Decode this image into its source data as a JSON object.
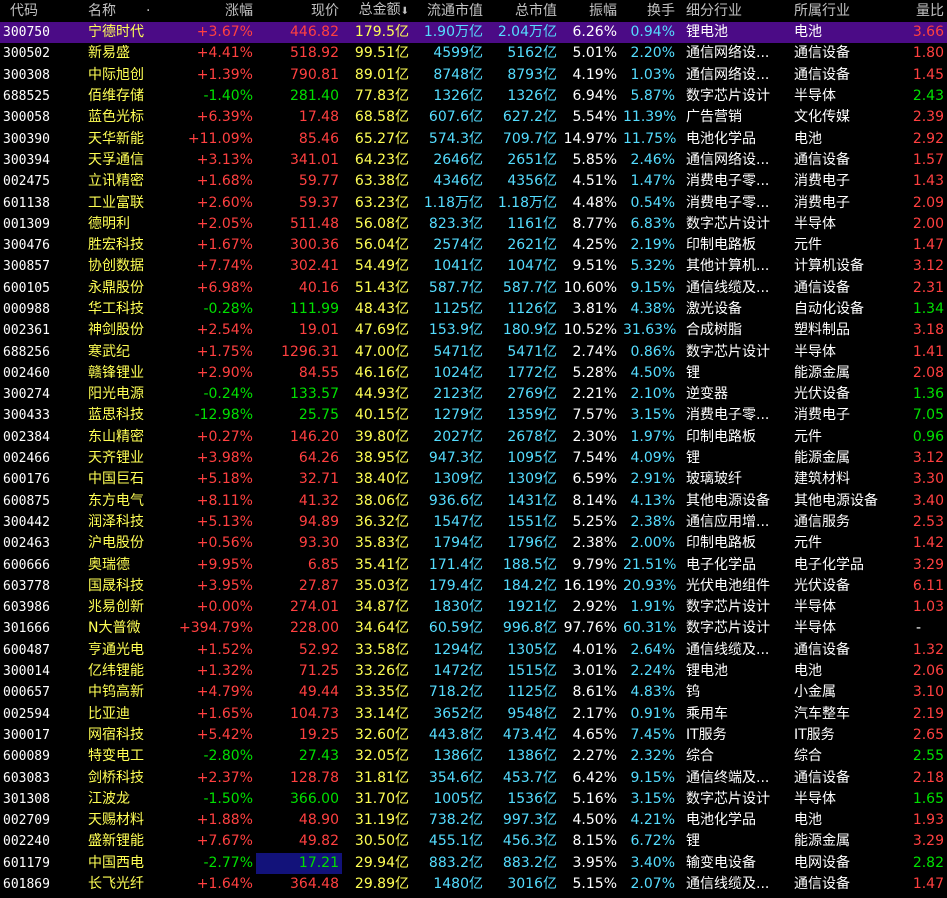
{
  "header": {
    "code": "代码",
    "name": "名称",
    "dot": "·",
    "change": "涨幅",
    "price": "现价",
    "amount": "总金额",
    "sort_arrow": "⬇",
    "float_cap": "流通市值",
    "total_cap": "总市值",
    "amplitude": "振幅",
    "turnover": "换手",
    "sub_industry": "细分行业",
    "industry": "所属行业",
    "volume_ratio": "量比"
  },
  "colors": {
    "up": "#ff4040",
    "down": "#00e000",
    "selected_row": "#4b0b86",
    "name": "#ffff55",
    "cap": "#55ddff"
  },
  "rows": [
    {
      "code": "300750",
      "name": "宁德时代",
      "change": "+3.67%",
      "price": "446.82",
      "amount": "179.5亿",
      "float_cap": "1.90万亿",
      "total_cap": "2.04万亿",
      "amplitude": "6.26%",
      "turnover": "0.94%",
      "sub_industry": "锂电池",
      "industry": "电池",
      "volume_ratio": "3.66",
      "dir": "up",
      "selected": true
    },
    {
      "code": "300502",
      "name": "新易盛",
      "change": "+4.41%",
      "price": "518.92",
      "amount": "99.51亿",
      "float_cap": "4599亿",
      "total_cap": "5162亿",
      "amplitude": "5.01%",
      "turnover": "2.20%",
      "sub_industry": "通信网络设...",
      "industry": "通信设备",
      "volume_ratio": "1.80",
      "dir": "up"
    },
    {
      "code": "300308",
      "name": "中际旭创",
      "change": "+1.39%",
      "price": "790.81",
      "amount": "89.01亿",
      "float_cap": "8748亿",
      "total_cap": "8793亿",
      "amplitude": "4.19%",
      "turnover": "1.03%",
      "sub_industry": "通信网络设...",
      "industry": "通信设备",
      "volume_ratio": "1.45",
      "dir": "up"
    },
    {
      "code": "688525",
      "name": "佰维存储",
      "change": "-1.40%",
      "price": "281.40",
      "amount": "77.83亿",
      "float_cap": "1326亿",
      "total_cap": "1326亿",
      "amplitude": "6.94%",
      "turnover": "5.87%",
      "sub_industry": "数字芯片设计",
      "industry": "半导体",
      "volume_ratio": "2.43",
      "dir": "dn"
    },
    {
      "code": "300058",
      "name": "蓝色光标",
      "change": "+6.39%",
      "price": "17.48",
      "amount": "68.58亿",
      "float_cap": "607.6亿",
      "total_cap": "627.2亿",
      "amplitude": "5.54%",
      "turnover": "11.39%",
      "sub_industry": "广告营销",
      "industry": "文化传媒",
      "volume_ratio": "2.39",
      "dir": "up"
    },
    {
      "code": "300390",
      "name": "天华新能",
      "change": "+11.09%",
      "price": "85.46",
      "amount": "65.27亿",
      "float_cap": "574.3亿",
      "total_cap": "709.7亿",
      "amplitude": "14.97%",
      "turnover": "11.75%",
      "sub_industry": "电池化学品",
      "industry": "电池",
      "volume_ratio": "2.92",
      "dir": "up"
    },
    {
      "code": "300394",
      "name": "天孚通信",
      "change": "+3.13%",
      "price": "341.01",
      "amount": "64.23亿",
      "float_cap": "2646亿",
      "total_cap": "2651亿",
      "amplitude": "5.85%",
      "turnover": "2.46%",
      "sub_industry": "通信网络设...",
      "industry": "通信设备",
      "volume_ratio": "1.57",
      "dir": "up"
    },
    {
      "code": "002475",
      "name": "立讯精密",
      "change": "+1.68%",
      "price": "59.77",
      "amount": "63.38亿",
      "float_cap": "4346亿",
      "total_cap": "4356亿",
      "amplitude": "4.51%",
      "turnover": "1.47%",
      "sub_industry": "消费电子零...",
      "industry": "消费电子",
      "volume_ratio": "1.43",
      "dir": "up"
    },
    {
      "code": "601138",
      "name": "工业富联",
      "change": "+2.60%",
      "price": "59.37",
      "amount": "63.23亿",
      "float_cap": "1.18万亿",
      "total_cap": "1.18万亿",
      "amplitude": "4.48%",
      "turnover": "0.54%",
      "sub_industry": "消费电子零...",
      "industry": "消费电子",
      "volume_ratio": "2.09",
      "dir": "up"
    },
    {
      "code": "001309",
      "name": "德明利",
      "change": "+2.05%",
      "price": "511.48",
      "amount": "56.08亿",
      "float_cap": "823.3亿",
      "total_cap": "1161亿",
      "amplitude": "8.77%",
      "turnover": "6.83%",
      "sub_industry": "数字芯片设计",
      "industry": "半导体",
      "volume_ratio": "2.00",
      "dir": "up"
    },
    {
      "code": "300476",
      "name": "胜宏科技",
      "change": "+1.67%",
      "price": "300.36",
      "amount": "56.04亿",
      "float_cap": "2574亿",
      "total_cap": "2621亿",
      "amplitude": "4.25%",
      "turnover": "2.19%",
      "sub_industry": "印制电路板",
      "industry": "元件",
      "volume_ratio": "1.47",
      "dir": "up"
    },
    {
      "code": "300857",
      "name": "协创数据",
      "change": "+7.74%",
      "price": "302.41",
      "amount": "54.49亿",
      "float_cap": "1041亿",
      "total_cap": "1047亿",
      "amplitude": "9.51%",
      "turnover": "5.32%",
      "sub_industry": "其他计算机...",
      "industry": "计算机设备",
      "volume_ratio": "3.12",
      "dir": "up"
    },
    {
      "code": "600105",
      "name": "永鼎股份",
      "change": "+6.98%",
      "price": "40.16",
      "amount": "51.43亿",
      "float_cap": "587.7亿",
      "total_cap": "587.7亿",
      "amplitude": "10.60%",
      "turnover": "9.15%",
      "sub_industry": "通信线缆及...",
      "industry": "通信设备",
      "volume_ratio": "2.31",
      "dir": "up"
    },
    {
      "code": "000988",
      "name": "华工科技",
      "change": "-0.28%",
      "price": "111.99",
      "amount": "48.43亿",
      "float_cap": "1125亿",
      "total_cap": "1126亿",
      "amplitude": "3.81%",
      "turnover": "4.38%",
      "sub_industry": "激光设备",
      "industry": "自动化设备",
      "volume_ratio": "1.34",
      "dir": "dn"
    },
    {
      "code": "002361",
      "name": "神剑股份",
      "change": "+2.54%",
      "price": "19.01",
      "amount": "47.69亿",
      "float_cap": "153.9亿",
      "total_cap": "180.9亿",
      "amplitude": "10.52%",
      "turnover": "31.63%",
      "sub_industry": "合成树脂",
      "industry": "塑料制品",
      "volume_ratio": "3.18",
      "dir": "up"
    },
    {
      "code": "688256",
      "name": "寒武纪",
      "change": "+1.75%",
      "price": "1296.31",
      "amount": "47.00亿",
      "float_cap": "5471亿",
      "total_cap": "5471亿",
      "amplitude": "2.74%",
      "turnover": "0.86%",
      "sub_industry": "数字芯片设计",
      "industry": "半导体",
      "volume_ratio": "1.41",
      "dir": "up"
    },
    {
      "code": "002460",
      "name": "赣锋锂业",
      "change": "+2.90%",
      "price": "84.55",
      "amount": "46.16亿",
      "float_cap": "1024亿",
      "total_cap": "1772亿",
      "amplitude": "5.28%",
      "turnover": "4.50%",
      "sub_industry": "锂",
      "industry": "能源金属",
      "volume_ratio": "2.08",
      "dir": "up"
    },
    {
      "code": "300274",
      "name": "阳光电源",
      "change": "-0.24%",
      "price": "133.57",
      "amount": "44.93亿",
      "float_cap": "2123亿",
      "total_cap": "2769亿",
      "amplitude": "2.21%",
      "turnover": "2.10%",
      "sub_industry": "逆变器",
      "industry": "光伏设备",
      "volume_ratio": "1.36",
      "dir": "dn"
    },
    {
      "code": "300433",
      "name": "蓝思科技",
      "change": "-12.98%",
      "price": "25.75",
      "amount": "40.15亿",
      "float_cap": "1279亿",
      "total_cap": "1359亿",
      "amplitude": "7.57%",
      "turnover": "3.15%",
      "sub_industry": "消费电子零...",
      "industry": "消费电子",
      "volume_ratio": "7.05",
      "dir": "dn"
    },
    {
      "code": "002384",
      "name": "东山精密",
      "change": "+0.27%",
      "price": "146.20",
      "amount": "39.80亿",
      "float_cap": "2027亿",
      "total_cap": "2678亿",
      "amplitude": "2.30%",
      "turnover": "1.97%",
      "sub_industry": "印制电路板",
      "industry": "元件",
      "volume_ratio": "0.96",
      "dir": "up",
      "vr_dir": "dn"
    },
    {
      "code": "002466",
      "name": "天齐锂业",
      "change": "+3.98%",
      "price": "64.26",
      "amount": "38.95亿",
      "float_cap": "947.3亿",
      "total_cap": "1095亿",
      "amplitude": "7.54%",
      "turnover": "4.09%",
      "sub_industry": "锂",
      "industry": "能源金属",
      "volume_ratio": "3.12",
      "dir": "up"
    },
    {
      "code": "600176",
      "name": "中国巨石",
      "change": "+5.18%",
      "price": "32.71",
      "amount": "38.40亿",
      "float_cap": "1309亿",
      "total_cap": "1309亿",
      "amplitude": "6.59%",
      "turnover": "2.91%",
      "sub_industry": "玻璃玻纤",
      "industry": "建筑材料",
      "volume_ratio": "3.30",
      "dir": "up"
    },
    {
      "code": "600875",
      "name": "东方电气",
      "change": "+8.11%",
      "price": "41.32",
      "amount": "38.06亿",
      "float_cap": "936.6亿",
      "total_cap": "1431亿",
      "amplitude": "8.14%",
      "turnover": "4.13%",
      "sub_industry": "其他电源设备",
      "industry": "其他电源设备",
      "volume_ratio": "3.40",
      "dir": "up"
    },
    {
      "code": "300442",
      "name": "润泽科技",
      "change": "+5.13%",
      "price": "94.89",
      "amount": "36.32亿",
      "float_cap": "1547亿",
      "total_cap": "1551亿",
      "amplitude": "5.25%",
      "turnover": "2.38%",
      "sub_industry": "通信应用增...",
      "industry": "通信服务",
      "volume_ratio": "2.53",
      "dir": "up"
    },
    {
      "code": "002463",
      "name": "沪电股份",
      "change": "+0.56%",
      "price": "93.30",
      "amount": "35.83亿",
      "float_cap": "1794亿",
      "total_cap": "1796亿",
      "amplitude": "2.38%",
      "turnover": "2.00%",
      "sub_industry": "印制电路板",
      "industry": "元件",
      "volume_ratio": "1.42",
      "dir": "up"
    },
    {
      "code": "600666",
      "name": "奥瑞德",
      "change": "+9.95%",
      "price": "6.85",
      "amount": "35.41亿",
      "float_cap": "171.4亿",
      "total_cap": "188.5亿",
      "amplitude": "9.79%",
      "turnover": "21.51%",
      "sub_industry": "电子化学品",
      "industry": "电子化学品",
      "volume_ratio": "3.29",
      "dir": "up"
    },
    {
      "code": "603778",
      "name": "国晟科技",
      "change": "+3.95%",
      "price": "27.87",
      "amount": "35.03亿",
      "float_cap": "179.4亿",
      "total_cap": "184.2亿",
      "amplitude": "16.19%",
      "turnover": "20.93%",
      "sub_industry": "光伏电池组件",
      "industry": "光伏设备",
      "volume_ratio": "6.11",
      "dir": "up"
    },
    {
      "code": "603986",
      "name": "兆易创新",
      "change": "+0.00%",
      "price": "274.01",
      "amount": "34.87亿",
      "float_cap": "1830亿",
      "total_cap": "1921亿",
      "amplitude": "2.92%",
      "turnover": "1.91%",
      "sub_industry": "数字芯片设计",
      "industry": "半导体",
      "volume_ratio": "1.03",
      "dir": "up"
    },
    {
      "code": "301666",
      "name": "N大普微",
      "name_mark": "N",
      "name_rest": "大普微",
      "change": "+394.79%",
      "price": "228.00",
      "amount": "34.64亿",
      "float_cap": "60.59亿",
      "total_cap": "996.8亿",
      "amplitude": "97.76%",
      "turnover": "60.31%",
      "sub_industry": "数字芯片设计",
      "industry": "半导体",
      "volume_ratio": "-",
      "dir": "up",
      "vr_dir": "na"
    },
    {
      "code": "600487",
      "name": "亨通光电",
      "change": "+1.52%",
      "price": "52.92",
      "amount": "33.58亿",
      "float_cap": "1294亿",
      "total_cap": "1305亿",
      "amplitude": "4.01%",
      "turnover": "2.64%",
      "sub_industry": "通信线缆及...",
      "industry": "通信设备",
      "volume_ratio": "1.32",
      "dir": "up"
    },
    {
      "code": "300014",
      "name": "亿纬锂能",
      "change": "+1.32%",
      "price": "71.25",
      "amount": "33.26亿",
      "float_cap": "1472亿",
      "total_cap": "1515亿",
      "amplitude": "3.01%",
      "turnover": "2.24%",
      "sub_industry": "锂电池",
      "industry": "电池",
      "volume_ratio": "2.06",
      "dir": "up"
    },
    {
      "code": "000657",
      "name": "中钨高新",
      "change": "+4.79%",
      "price": "49.44",
      "amount": "33.35亿",
      "float_cap": "718.2亿",
      "total_cap": "1125亿",
      "amplitude": "8.61%",
      "turnover": "4.83%",
      "sub_industry": "钨",
      "industry": "小金属",
      "volume_ratio": "3.10",
      "dir": "up"
    },
    {
      "code": "002594",
      "name": "比亚迪",
      "change": "+1.65%",
      "price": "104.73",
      "amount": "33.14亿",
      "float_cap": "3652亿",
      "total_cap": "9548亿",
      "amplitude": "2.17%",
      "turnover": "0.91%",
      "sub_industry": "乘用车",
      "industry": "汽车整车",
      "volume_ratio": "2.19",
      "dir": "up"
    },
    {
      "code": "300017",
      "name": "网宿科技",
      "change": "+5.42%",
      "price": "19.25",
      "amount": "32.60亿",
      "float_cap": "443.8亿",
      "total_cap": "473.4亿",
      "amplitude": "4.65%",
      "turnover": "7.45%",
      "sub_industry": "IT服务",
      "industry": "IT服务",
      "volume_ratio": "2.65",
      "dir": "up"
    },
    {
      "code": "600089",
      "name": "特变电工",
      "change": "-2.80%",
      "price": "27.43",
      "amount": "32.05亿",
      "float_cap": "1386亿",
      "total_cap": "1386亿",
      "amplitude": "2.27%",
      "turnover": "2.32%",
      "sub_industry": "综合",
      "industry": "综合",
      "volume_ratio": "2.55",
      "dir": "dn"
    },
    {
      "code": "603083",
      "name": "剑桥科技",
      "change": "+2.37%",
      "price": "128.78",
      "amount": "31.81亿",
      "float_cap": "354.6亿",
      "total_cap": "453.7亿",
      "amplitude": "6.42%",
      "turnover": "9.15%",
      "sub_industry": "通信终端及...",
      "industry": "通信设备",
      "volume_ratio": "2.18",
      "dir": "up"
    },
    {
      "code": "301308",
      "name": "江波龙",
      "change": "-1.50%",
      "price": "366.00",
      "amount": "31.70亿",
      "float_cap": "1005亿",
      "total_cap": "1536亿",
      "amplitude": "5.16%",
      "turnover": "3.15%",
      "sub_industry": "数字芯片设计",
      "industry": "半导体",
      "volume_ratio": "1.65",
      "dir": "dn"
    },
    {
      "code": "002709",
      "name": "天赐材料",
      "change": "+1.88%",
      "price": "48.90",
      "amount": "31.19亿",
      "float_cap": "738.2亿",
      "total_cap": "997.3亿",
      "amplitude": "4.50%",
      "turnover": "4.21%",
      "sub_industry": "电池化学品",
      "industry": "电池",
      "volume_ratio": "1.93",
      "dir": "up"
    },
    {
      "code": "002240",
      "name": "盛新锂能",
      "change": "+7.67%",
      "price": "49.82",
      "amount": "30.50亿",
      "float_cap": "455.1亿",
      "total_cap": "456.3亿",
      "amplitude": "8.15%",
      "turnover": "6.72%",
      "sub_industry": "锂",
      "industry": "能源金属",
      "volume_ratio": "3.29",
      "dir": "up"
    },
    {
      "code": "601179",
      "name": "中国西电",
      "change": "-2.77%",
      "price": "17.21",
      "amount": "29.94亿",
      "float_cap": "883.2亿",
      "total_cap": "883.2亿",
      "amplitude": "3.95%",
      "turnover": "3.40%",
      "sub_industry": "输变电设备",
      "industry": "电网设备",
      "volume_ratio": "2.82",
      "dir": "dn",
      "price_highlight": true
    },
    {
      "code": "601869",
      "name": "长飞光纤",
      "change": "+1.64%",
      "price": "364.48",
      "amount": "29.89亿",
      "float_cap": "1480亿",
      "total_cap": "3016亿",
      "amplitude": "5.15%",
      "turnover": "2.07%",
      "sub_industry": "通信线缆及...",
      "industry": "通信设备",
      "volume_ratio": "1.47",
      "dir": "up"
    }
  ]
}
